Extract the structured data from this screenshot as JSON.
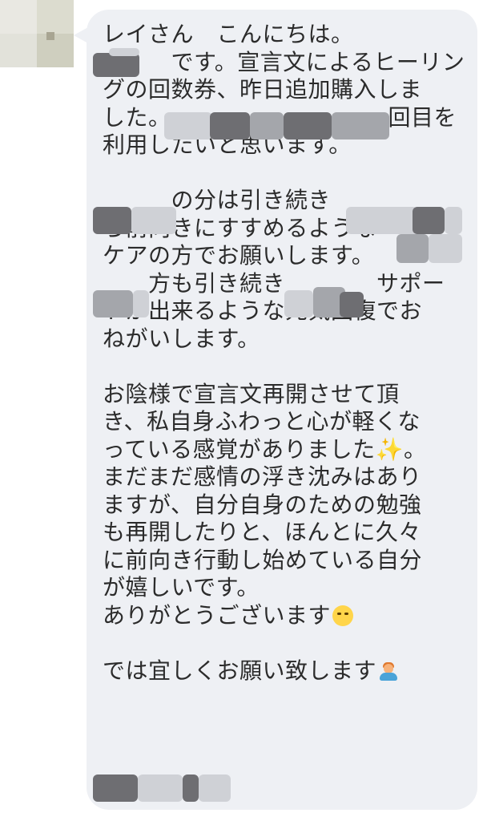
{
  "message": {
    "lines": [
      "レイさん　こんにちは。",
      "　　　です。宣言文によるヒーリン",
      "グの回数券、昨日追加購入しま",
      "した。　　　　　　　　　　回目を",
      "利用したいと思います。",
      "",
      "　　　の分は引き続き",
      "ら前向きにすすめるような",
      "ケアの方でお願いします。",
      "　　方も引き続き　　　　サポー",
      "トが出来るような元気回復でお",
      "ねがいします。",
      "",
      "お陰様で宣言文再開させて頂",
      "き、私自身ふわっと心が軽くな",
      "っている感覚がありました",
      "まだまだ感情の浮き沈みはあり",
      "ますが、自分自身のための勉強",
      "も再開したりと、ほんとに久々",
      "に前向き行動し始めている自分",
      "が嬉しいです。",
      "ありがとうございます",
      "",
      "では宜しくお願い致します"
    ],
    "line_16_suffix": "。",
    "emoji": {
      "sparkles": "✨",
      "crying_face": "crying-face-icon",
      "bowing_person": "bowing-person-icon"
    }
  },
  "colors": {
    "bubble": "#eef0f4",
    "text": "#2b2b2b",
    "redaction_dark": "#6e6e72",
    "redaction_mid": "#a4a6ab",
    "redaction_light": "#cfd1d6"
  }
}
